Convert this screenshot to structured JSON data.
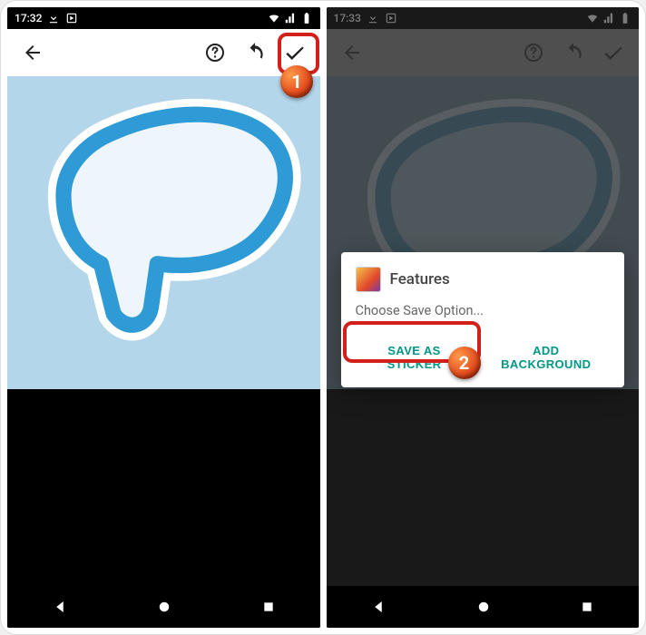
{
  "status": {
    "time1": "17:32",
    "time2": "17:33"
  },
  "toolbar": {
    "back_name": "back-icon",
    "help_name": "help-icon",
    "undo_name": "undo-icon",
    "done_name": "check-icon"
  },
  "dialog": {
    "title": "Features",
    "message": "Choose Save Option...",
    "save_sticker": "SAVE AS STICKER",
    "add_background": "ADD BACKGROUND"
  },
  "callouts": {
    "one": "1",
    "two": "2"
  },
  "nav": {
    "back": "nav-back",
    "home": "nav-home",
    "recent": "nav-recent"
  }
}
